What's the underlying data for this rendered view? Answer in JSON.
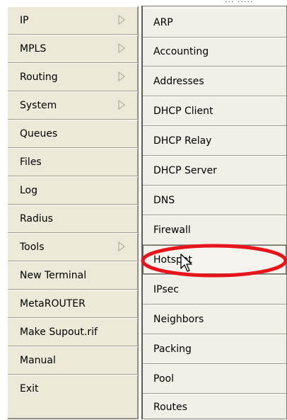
{
  "top_fragment": "··· ·····",
  "left_menu": {
    "items": [
      {
        "label": "IP",
        "submenu": true
      },
      {
        "label": "MPLS",
        "submenu": true
      },
      {
        "label": "Routing",
        "submenu": true
      },
      {
        "label": "System",
        "submenu": true
      },
      {
        "label": "Queues",
        "submenu": false
      },
      {
        "label": "Files",
        "submenu": false
      },
      {
        "label": "Log",
        "submenu": false
      },
      {
        "label": "Radius",
        "submenu": false
      },
      {
        "label": "Tools",
        "submenu": true
      },
      {
        "label": "New Terminal",
        "submenu": false
      },
      {
        "label": "MetaROUTER",
        "submenu": false
      },
      {
        "label": "Make Supout.rif",
        "submenu": false
      },
      {
        "label": "Manual",
        "submenu": false
      },
      {
        "label": "Exit",
        "submenu": false
      }
    ]
  },
  "ip_submenu": {
    "items": [
      {
        "label": "ARP"
      },
      {
        "label": "Accounting"
      },
      {
        "label": "Addresses"
      },
      {
        "label": "DHCP Client"
      },
      {
        "label": "DHCP Relay"
      },
      {
        "label": "DHCP Server"
      },
      {
        "label": "DNS"
      },
      {
        "label": "Firewall"
      },
      {
        "label": "Hotspot",
        "highlighted": true
      },
      {
        "label": "IPsec"
      },
      {
        "label": "Neighbors"
      },
      {
        "label": "Packing"
      },
      {
        "label": "Pool"
      },
      {
        "label": "Routes"
      }
    ]
  },
  "colors": {
    "menu_bg": "#ece9d8",
    "annotation_red": "#e8141b"
  },
  "icons": {
    "submenu_arrow": "submenu-arrow-icon",
    "cursor": "mouse-pointer-icon",
    "highlight": "red-ellipse-annotation"
  }
}
